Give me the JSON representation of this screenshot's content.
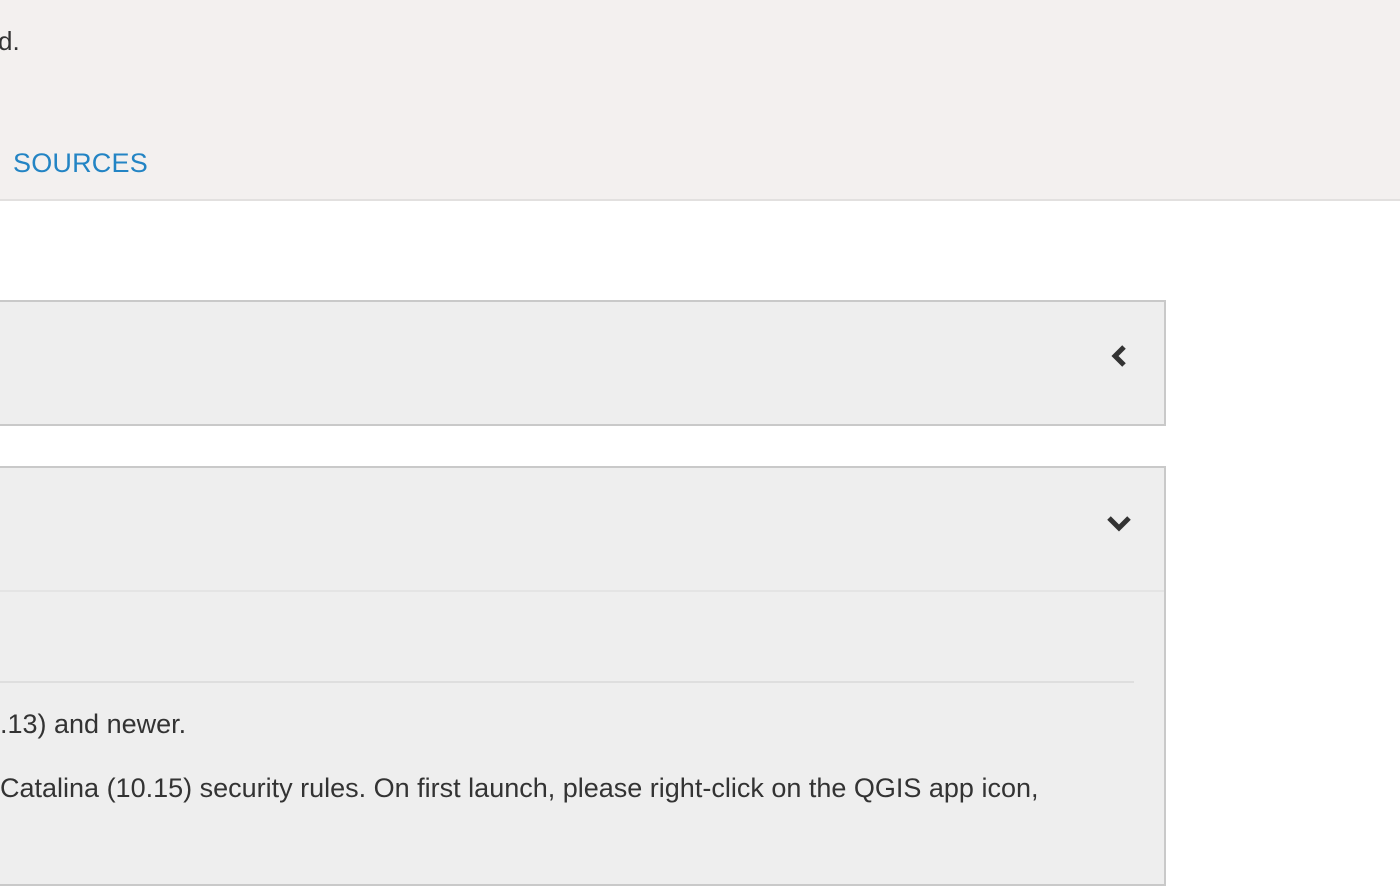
{
  "header": {
    "text": "d.",
    "nav_link": "SOURCES"
  },
  "panels": [
    {
      "state": "collapsed",
      "icon": "chevron-left-icon"
    },
    {
      "state": "expanded",
      "icon": "chevron-down-icon",
      "lines": [
        ".13) and newer.",
        "Catalina (10.15) security rules. On first launch, please right-click on the QGIS app icon,"
      ]
    }
  ],
  "colors": {
    "header_background": "#f3f0ef",
    "link": "#2384c4",
    "panel_background": "#eeeeee",
    "panel_border": "#c9c9c9",
    "text": "#333333"
  }
}
